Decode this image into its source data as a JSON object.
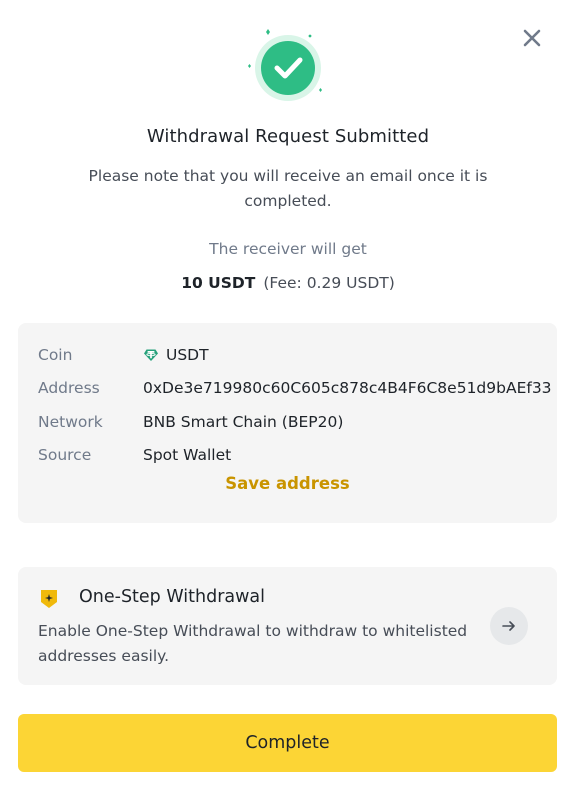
{
  "dialog": {
    "title": "Withdrawal Request Submitted",
    "note": "Please note that you will receive an email once it is completed.",
    "receiver_label": "The receiver will get",
    "amount": "10 USDT",
    "fee": "(Fee: 0.29 USDT)"
  },
  "details": {
    "rows": [
      {
        "label": "Coin",
        "value": "USDT",
        "icon": "tether-icon"
      },
      {
        "label": "Address",
        "value": "0xDe3e719980c60C605c878c4B4F6C8e51d9bAEf33"
      },
      {
        "label": "Network",
        "value": "BNB Smart Chain (BEP20)"
      },
      {
        "label": "Source",
        "value": "Spot Wallet"
      }
    ],
    "save_address_label": "Save address"
  },
  "one_step": {
    "title": "One-Step Withdrawal",
    "description": "Enable One-Step Withdrawal to withdraw to whitelisted addresses easily."
  },
  "complete_label": "Complete",
  "colors": {
    "accent_yellow": "#fcd535",
    "link_gold": "#c99400",
    "success_green": "#2ebd85",
    "card_bg": "#f5f5f5",
    "tether_green": "#26a17b"
  },
  "icons": [
    "close-icon",
    "success-check-icon",
    "tether-icon",
    "shield-icon",
    "arrow-right-icon"
  ]
}
